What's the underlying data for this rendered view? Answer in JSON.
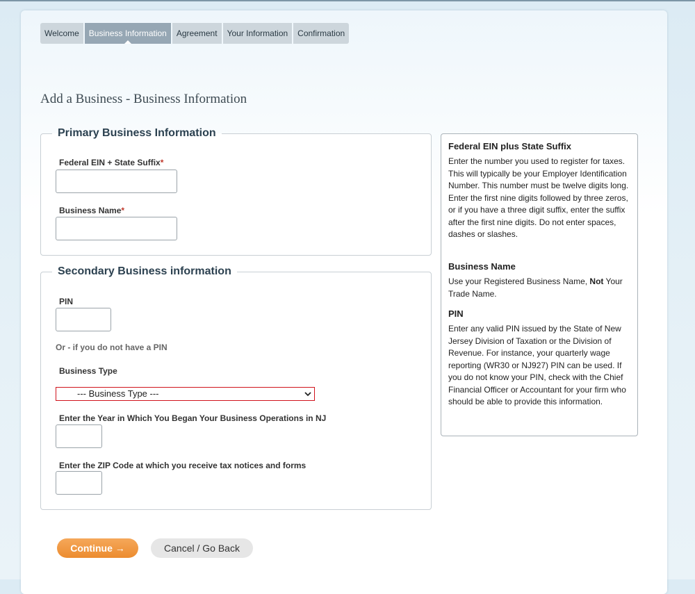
{
  "tabs": [
    {
      "label": "Welcome"
    },
    {
      "label": "Business Information"
    },
    {
      "label": "Agreement"
    },
    {
      "label": "Your Information"
    },
    {
      "label": "Confirmation"
    }
  ],
  "page_title": "Add a Business - Business Information",
  "primary": {
    "legend": "Primary Business Information",
    "ein_label": "Federal EIN + State Suffix",
    "required_mark": "*",
    "business_name_label": "Business Name"
  },
  "secondary": {
    "legend": "Secondary Business information",
    "pin_label": "PIN",
    "or_text": "Or - if you do not have a PIN",
    "business_type_label": "Business Type",
    "business_type_selected": "--- Business Type ---",
    "year_label_pre": "Enter the ",
    "year_label_bold": "Year",
    "year_label_post": " in Which You Began Your Business Operations in NJ",
    "zip_label_pre": "Enter the ",
    "zip_label_bold": "ZIP Code",
    "zip_label_post": " at which you receive tax notices and forms"
  },
  "help": {
    "ein_title": "Federal EIN plus State Suffix",
    "ein_text": "Enter the number you used to register for taxes. This will typically be your Employer Identification Number. This number must be twelve digits long. Enter the first nine digits followed by three zeros, or if you have a three digit suffix, enter the suffix after the first nine digits. Do not enter spaces, dashes or slashes.",
    "name_title": "Business Name",
    "name_text_pre": "Use your Registered Business Name, ",
    "name_text_bold": "Not",
    "name_text_post": " Your Trade Name.",
    "pin_title": "PIN",
    "pin_text": "Enter any valid PIN issued by the State of New Jersey Division of Taxation or the Division of Revenue. For instance, your quarterly wage reporting (WR30 or NJ927) PIN can be used. If you do not know your PIN, check with the Chief Financial Officer or Accountant for your firm who should be able to provide this information."
  },
  "buttons": {
    "continue": "Continue →",
    "cancel": "Cancel / Go Back"
  },
  "colors": {
    "accent_orange": "#ec8c2f",
    "tab_active": "#96a7b4",
    "tab_inactive": "#cdd6dc",
    "required": "#c0392b"
  }
}
